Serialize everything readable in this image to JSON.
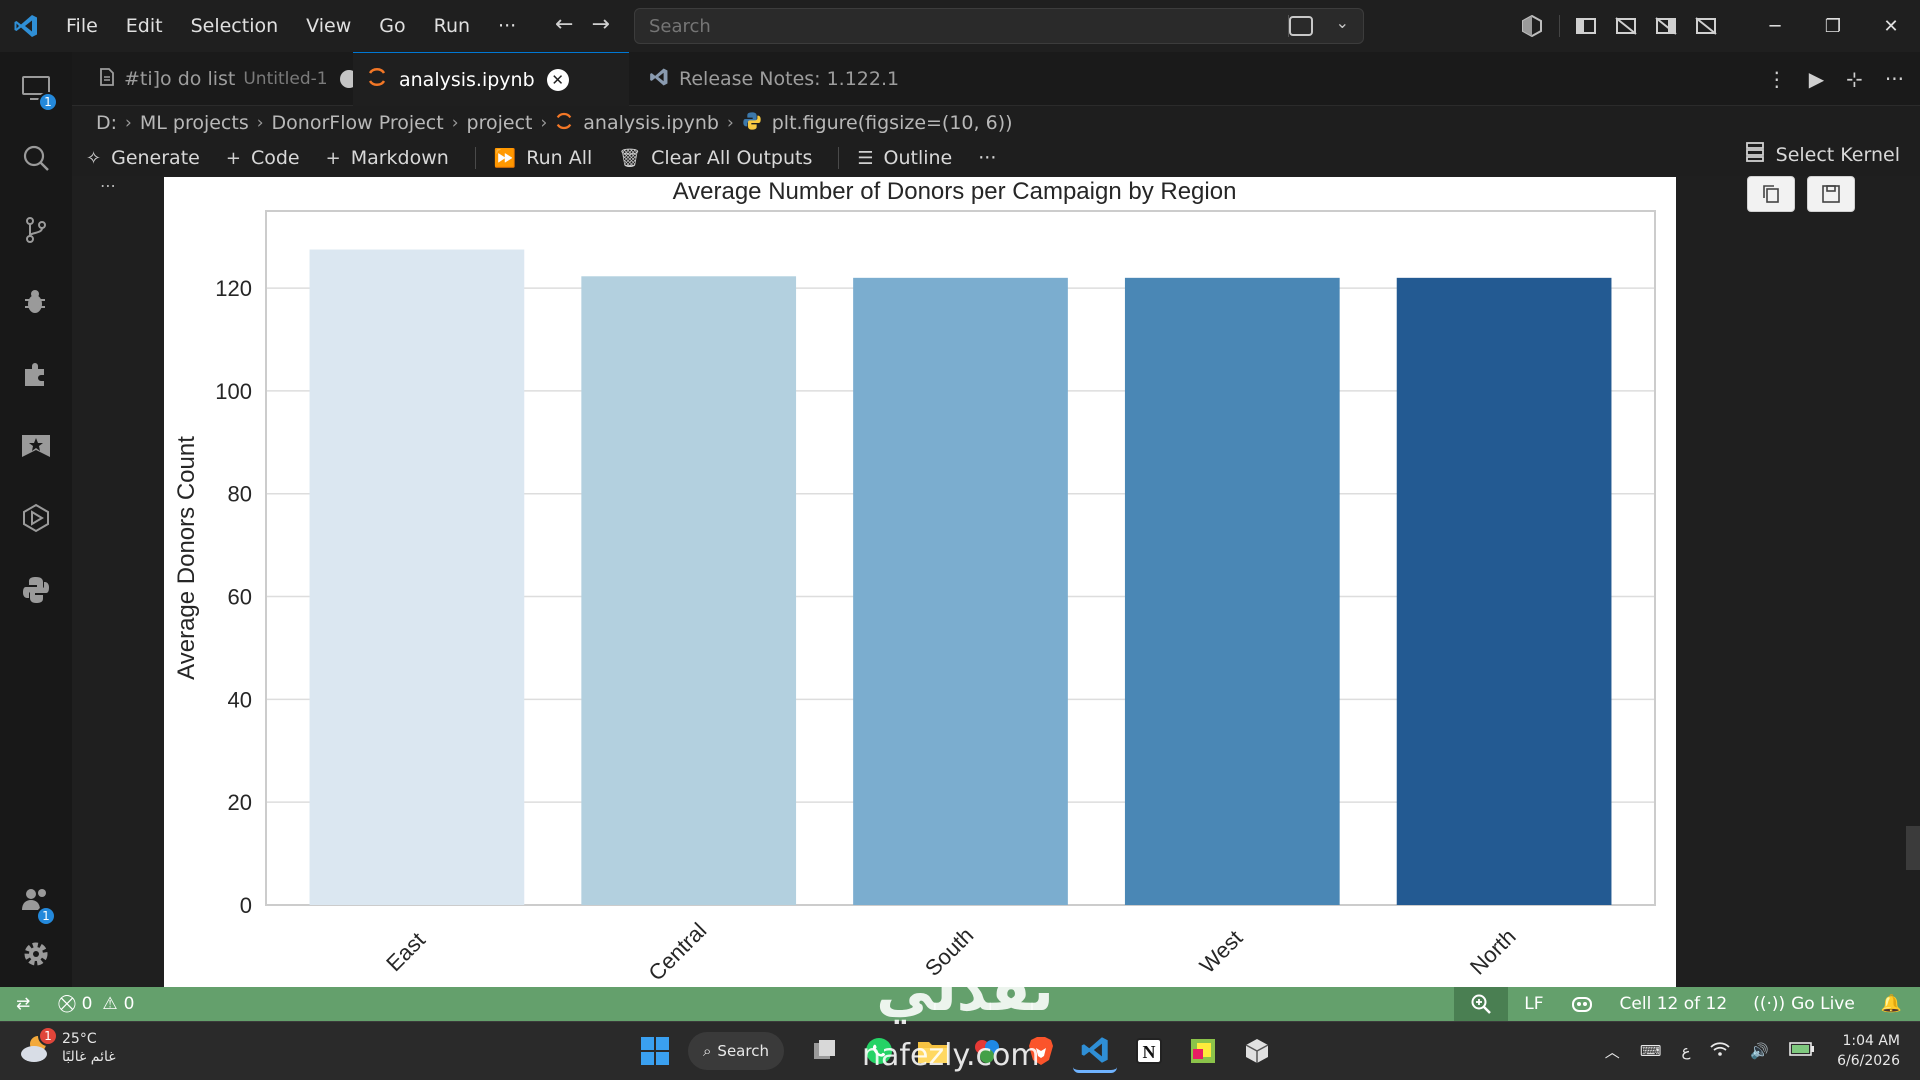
{
  "menu": [
    "File",
    "Edit",
    "Selection",
    "View",
    "Go",
    "Run",
    "···"
  ],
  "search": {
    "placeholder": "Search"
  },
  "activity_badges": {
    "remote": "1",
    "accounts": "1"
  },
  "tabs": [
    {
      "label": "#ti]o do list",
      "sub": "Untitled-1",
      "state": "dirty"
    },
    {
      "label": "analysis.ipynb",
      "state": "active"
    },
    {
      "label": "Release Notes: 1.122.1",
      "state": "inactive"
    }
  ],
  "breadcrumb": [
    "D:",
    "ML projects",
    "DonorFlow Project",
    "project",
    "analysis.ipynb",
    "plt.figure(figsize=(10, 6))"
  ],
  "toolbar": {
    "generate": "Generate",
    "code": "Code",
    "markdown": "Markdown",
    "run_all": "Run All",
    "clear_outputs": "Clear All Outputs",
    "outline": "Outline",
    "more": "···",
    "kernel": "Select Kernel"
  },
  "chart_data": {
    "type": "bar",
    "title": "Average Number of Donors per Campaign by Region",
    "xlabel": "",
    "ylabel": "Average Donors Count",
    "categories": [
      "East",
      "Central",
      "South",
      "West",
      "North"
    ],
    "values": [
      127.5,
      122.3,
      122.0,
      122.0,
      122.0
    ],
    "colors": [
      "#dbe7f1",
      "#b3d0df",
      "#7badcf",
      "#4a87b5",
      "#235a92"
    ],
    "ylim": [
      0,
      135
    ],
    "yticks": [
      "0",
      "20",
      "40",
      "60",
      "80",
      "100",
      "120"
    ],
    "grid": "horizontal"
  },
  "statusbar": {
    "errors": "0",
    "warnings": "0",
    "eol": "LF",
    "cell": "Cell 12 of 12",
    "golive": "Go Live"
  },
  "taskbar": {
    "temp": "25°C",
    "weather_desc": "غائم غالبًا",
    "weather_badge": "1",
    "search": "Search",
    "lang": "ع",
    "time": "1:04 AM",
    "date": "6/6/2026"
  },
  "watermark": {
    "arabic": "نفذلي",
    "domain": "nafezly.com"
  },
  "colors": {
    "statusbar": "#64a06c",
    "accent": "#0078d4",
    "badge": "#2489db"
  }
}
